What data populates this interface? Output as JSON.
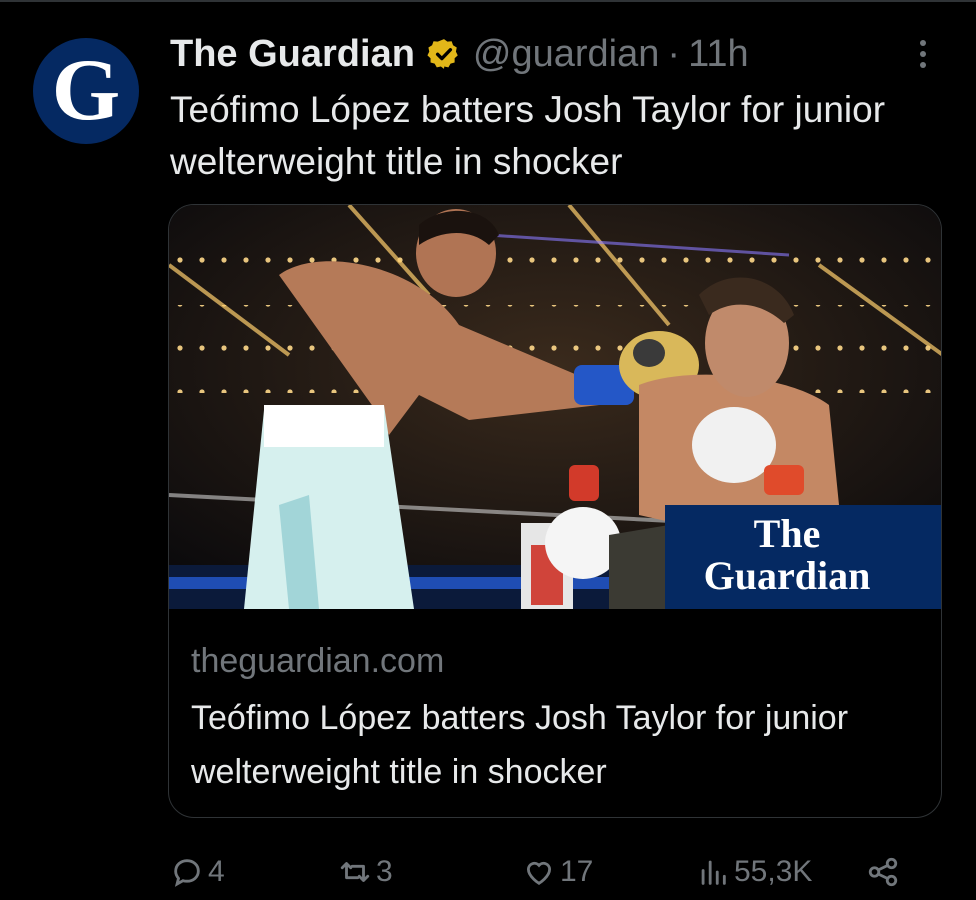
{
  "tweet": {
    "avatar_letter": "G",
    "author_name": "The Guardian",
    "handle": "@guardian",
    "separator": "·",
    "time": "11h",
    "text": "Teófimo López batters Josh Taylor for junior welterweight title in shocker"
  },
  "card": {
    "domain": "theguardian.com",
    "title": "Teófimo López batters Josh Taylor for junior welterweight title in shocker",
    "image_logo_line1": "The",
    "image_logo_line2": "Guardian"
  },
  "actions": {
    "replies": "4",
    "reposts": "3",
    "likes": "17",
    "views": "55,3K"
  },
  "colors": {
    "background": "#000000",
    "text": "#e7e9ea",
    "muted": "#71767b",
    "verified": "#e2b719",
    "guardian_blue": "#052962"
  },
  "icons": [
    "verified-badge-icon",
    "more-options-icon",
    "reply-icon",
    "repost-icon",
    "like-icon",
    "views-icon",
    "share-icon"
  ]
}
